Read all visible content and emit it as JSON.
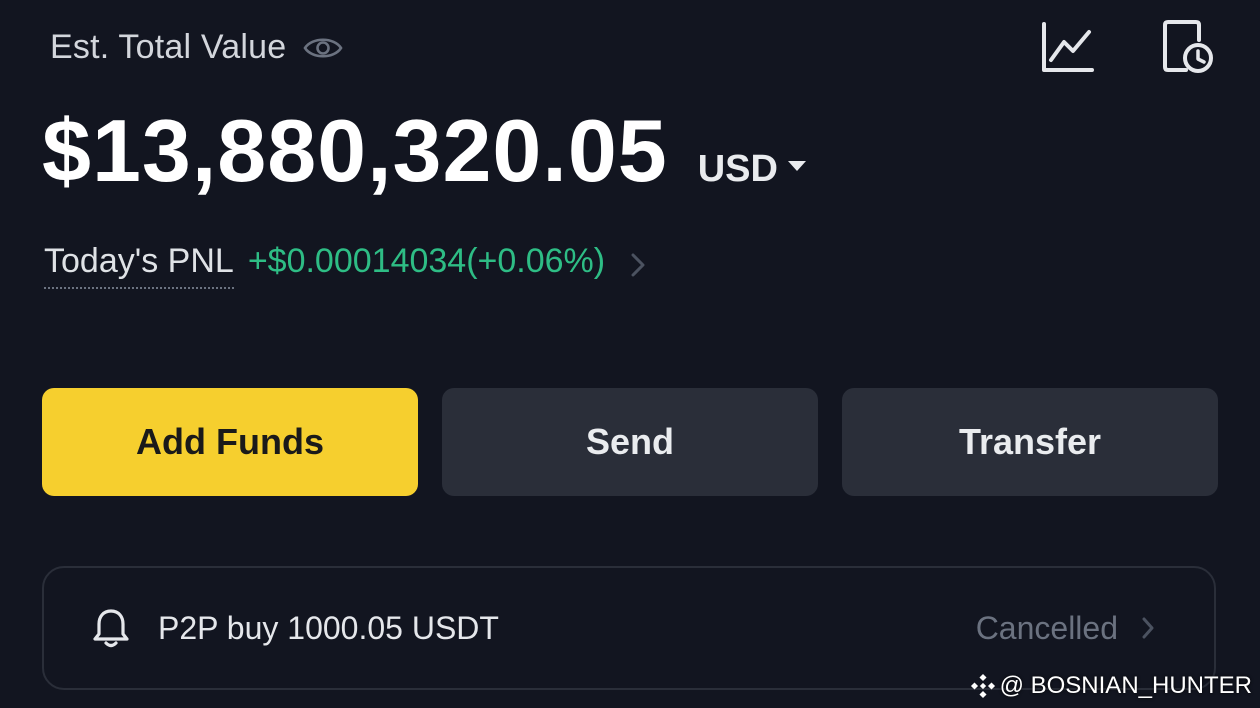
{
  "header": {
    "est_label": "Est. Total Value",
    "icons": [
      "eye-icon",
      "chart-icon",
      "history-icon"
    ]
  },
  "balance": {
    "amount": "$13,880,320.05",
    "currency": "USD"
  },
  "pnl": {
    "label": "Today's PNL",
    "value": "+$0.00014034(+0.06%)"
  },
  "actions": {
    "add_funds": "Add Funds",
    "send": "Send",
    "transfer": "Transfer"
  },
  "notice": {
    "text": "P2P buy 1000.05 USDT",
    "status": "Cancelled"
  },
  "watermark": {
    "text": "@ BOSNIAN_HUNTER"
  },
  "colors": {
    "background": "#121520",
    "accent": "#f6cf2e",
    "positive": "#2ebd85",
    "button_secondary": "#2a2e39"
  }
}
